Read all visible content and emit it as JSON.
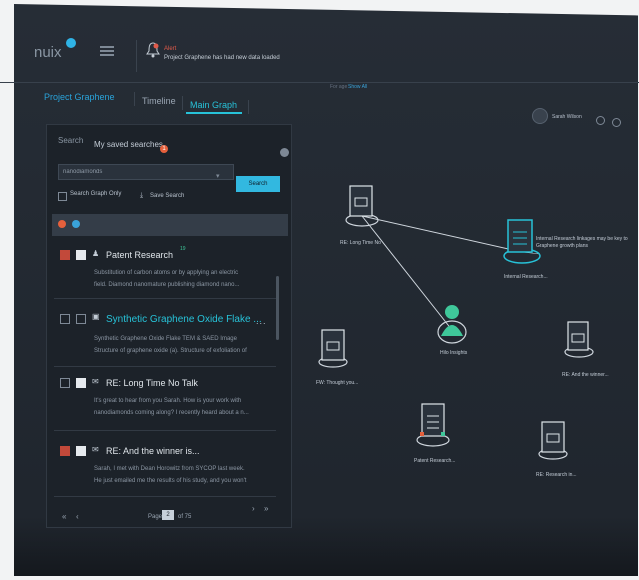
{
  "app": {
    "logo": "nuix"
  },
  "alert": {
    "title": "Alert",
    "text": "Project Graphene has had new data loaded",
    "for_age_label": "For age",
    "show_all": "Show All"
  },
  "tabs": [
    {
      "label": "Project Graphene"
    },
    {
      "label": "Timeline"
    },
    {
      "label": "Main Graph"
    }
  ],
  "user": {
    "name": "Sarah Wilson"
  },
  "search_panel": {
    "search_label": "Search",
    "saved_searches_label": "My saved searches",
    "saved_count": "1",
    "input_value": "nanodiamonds",
    "search_button": "Search",
    "search_graph_only": "Search Graph Only",
    "save_search": "Save Search"
  },
  "results": [
    {
      "title": "Patent Research",
      "badge": "19",
      "snippet1": "Substitution of carbon atoms or by applying an electric",
      "snippet2": "field. Diamond nanomature publishing diamond nano..."
    },
    {
      "title": "Synthetic Graphene Oxide Flake ...",
      "snippet1": "Synthetic Graphene Oxide Flake TEM & SAED Image",
      "snippet2": "Structure of graphene oxide (a). Structure of exfoliation of"
    },
    {
      "title": "RE: Long Time No Talk",
      "snippet1": "It's great to hear from you Sarah. How is your work with",
      "snippet2": "nanodiamonds coming along? I recently heard about a n..."
    },
    {
      "title": "RE: And the winner is...",
      "snippet1": "Sarah, I met with Dean Horowitz from SYCOP last week.",
      "snippet2": "He just emailed me the results of his study, and you won't"
    }
  ],
  "pager": {
    "page_label": "Page",
    "current": "2",
    "of_label": "of 75",
    "first": "«",
    "prev": "‹",
    "next": "›",
    "last": "»",
    "more": "..."
  },
  "graph": {
    "nodes": {
      "long_time": "RE: Long Time No",
      "internal": "Internal Research...",
      "person": "Hilo Insights",
      "thought": "FW: Thought you...",
      "winner": "RE: And the winner...",
      "patent": "Patent Research...",
      "research": "RE: Research in..."
    },
    "tooltip": "Internal Research linkages may be key to Graphene growth plans"
  },
  "colors": {
    "accent": "#2fb3e6",
    "alert": "#e05a4a",
    "node_person": "#3fc79a",
    "node_selected": "#27c2d8"
  }
}
